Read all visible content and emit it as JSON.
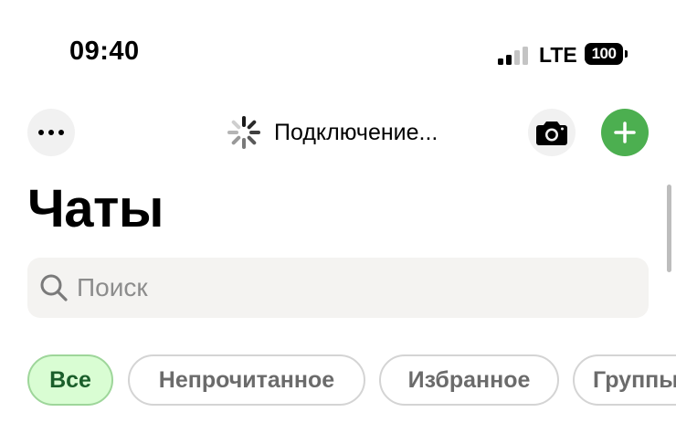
{
  "status_bar": {
    "time": "09:40",
    "network": "LTE",
    "battery": "100",
    "signal_icon": "signal-icon"
  },
  "top_bar": {
    "more_icon": "more-horizontal-icon",
    "connection_status": "Подключение...",
    "spinner_icon": "spinner-icon",
    "camera_icon": "camera-icon",
    "add_icon": "plus-icon",
    "accent_color": "#4caf50"
  },
  "page": {
    "title": "Чаты"
  },
  "search": {
    "placeholder": "Поиск",
    "value": "",
    "icon": "search-icon"
  },
  "filters": [
    {
      "label": "Все",
      "active": true
    },
    {
      "label": "Непрочитанное",
      "active": false
    },
    {
      "label": "Избранное",
      "active": false
    },
    {
      "label": "Группы",
      "active": false
    }
  ]
}
